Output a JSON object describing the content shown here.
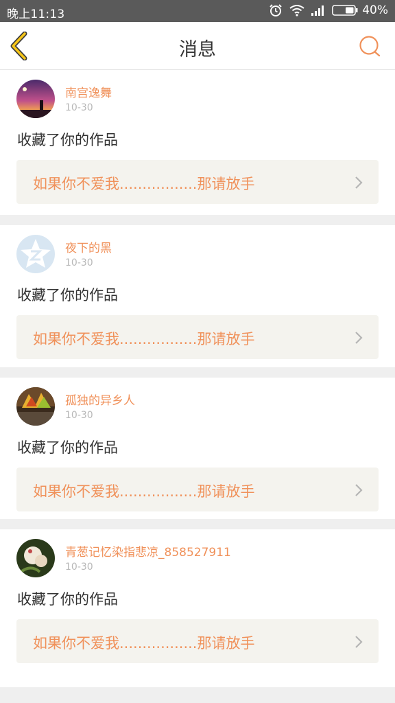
{
  "status_bar": {
    "time": "晚上11:13",
    "battery": "40%",
    "icons": [
      "alarm-icon",
      "wifi-icon",
      "signal-icon",
      "battery-icon"
    ]
  },
  "header": {
    "title": "消息",
    "back_icon": "chevron-left-icon",
    "search_icon": "search-icon"
  },
  "colors": {
    "accent": "#f0915a",
    "back_arrow": "#f5c518",
    "status_bar": "#5a5a5a",
    "card_bg": "#f4f3ee"
  },
  "messages": [
    {
      "name": "南宫逸舞",
      "date": "10-30",
      "action": "收藏了你的作品",
      "work_title": "如果你不爱我.................那请放手"
    },
    {
      "name": "夜下的黑",
      "date": "10-30",
      "action": "收藏了你的作品",
      "work_title": "如果你不爱我.................那请放手"
    },
    {
      "name": "孤独的异乡人",
      "date": "10-30",
      "action": "收藏了你的作品",
      "work_title": "如果你不爱我.................那请放手"
    },
    {
      "name": "青葱记忆染指悲凉_858527911",
      "date": "10-30",
      "action": "收藏了你的作品",
      "work_title": "如果你不爱我.................那请放手"
    }
  ]
}
